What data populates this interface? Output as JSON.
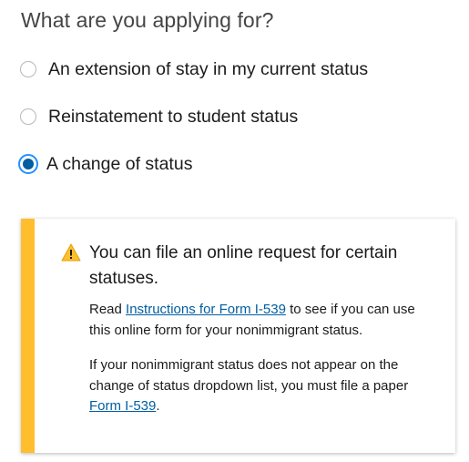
{
  "question": "What are you applying for?",
  "options": [
    {
      "label": "An extension of stay in my current status",
      "selected": false
    },
    {
      "label": "Reinstatement to student status",
      "selected": false
    },
    {
      "label": "A change of status",
      "selected": true
    }
  ],
  "alert": {
    "type": "warning",
    "icon": "warning-triangle-icon",
    "accent_color": "#ffbe2e",
    "heading": "You can file an online request for certain statuses.",
    "paragraph1": {
      "before": "Read ",
      "link": "Instructions for Form I-539",
      "after": " to see if you can use this online form for your nonimmigrant status."
    },
    "paragraph2": {
      "before": "If your nonimmigrant status does not appear on the change of status dropdown list, you must file a paper ",
      "link": "Form I-539",
      "after": "."
    }
  },
  "link_color": "#005ea2",
  "radio_selected_color": "#005ea2"
}
